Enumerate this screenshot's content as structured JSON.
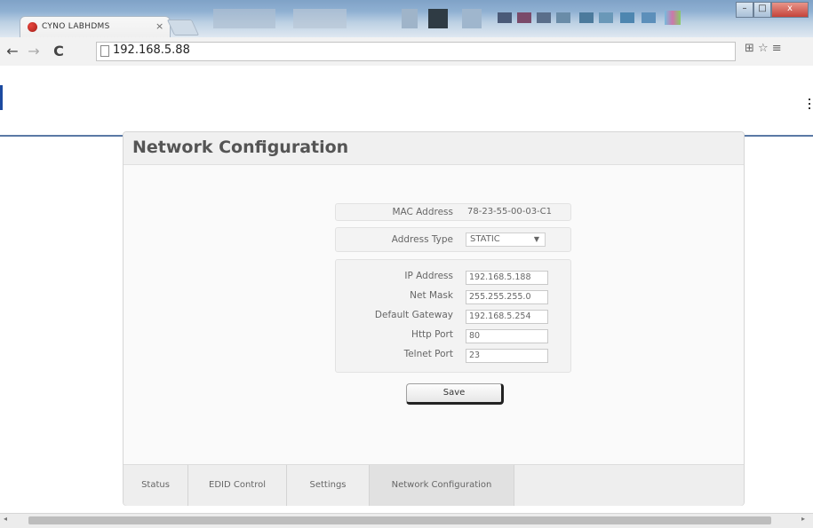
{
  "browser": {
    "tab_title": "CYNO LABHDMS",
    "tab_close": "×",
    "url": "192.168.5.88",
    "nav": {
      "back": "←",
      "forward": "→",
      "reload": "C"
    },
    "right_icons": "⊞ ☆ ≡",
    "window_buttons": {
      "minimize": "–",
      "maximize": "□",
      "close": "x"
    }
  },
  "panel": {
    "title": "Network Configuration",
    "mac": {
      "label": "MAC Address",
      "value": "78-23-55-00-03-C1"
    },
    "address_type": {
      "label": "Address Type",
      "value": "STATIC",
      "arrow": "▼"
    },
    "fields": [
      {
        "label": "IP Address",
        "value": "192.168.5.188"
      },
      {
        "label": "Net Mask",
        "value": "255.255.255.0"
      },
      {
        "label": "Default Gateway",
        "value": "192.168.5.254"
      },
      {
        "label": "Http Port",
        "value": "80"
      },
      {
        "label": "Telnet Port",
        "value": "23"
      }
    ],
    "save_label": "Save"
  },
  "tabs": [
    {
      "label": "Status",
      "active": false
    },
    {
      "label": "EDID Control",
      "active": false
    },
    {
      "label": "Settings",
      "active": false
    },
    {
      "label": "Network Configuration",
      "active": true
    }
  ],
  "scrollbar": {
    "left_arrow": "◂",
    "right_arrow": "▸"
  },
  "colors": {
    "header_line": "#5a79a5",
    "accent_left_bar": "#1c4aa0",
    "close_button": "#c4433a"
  }
}
